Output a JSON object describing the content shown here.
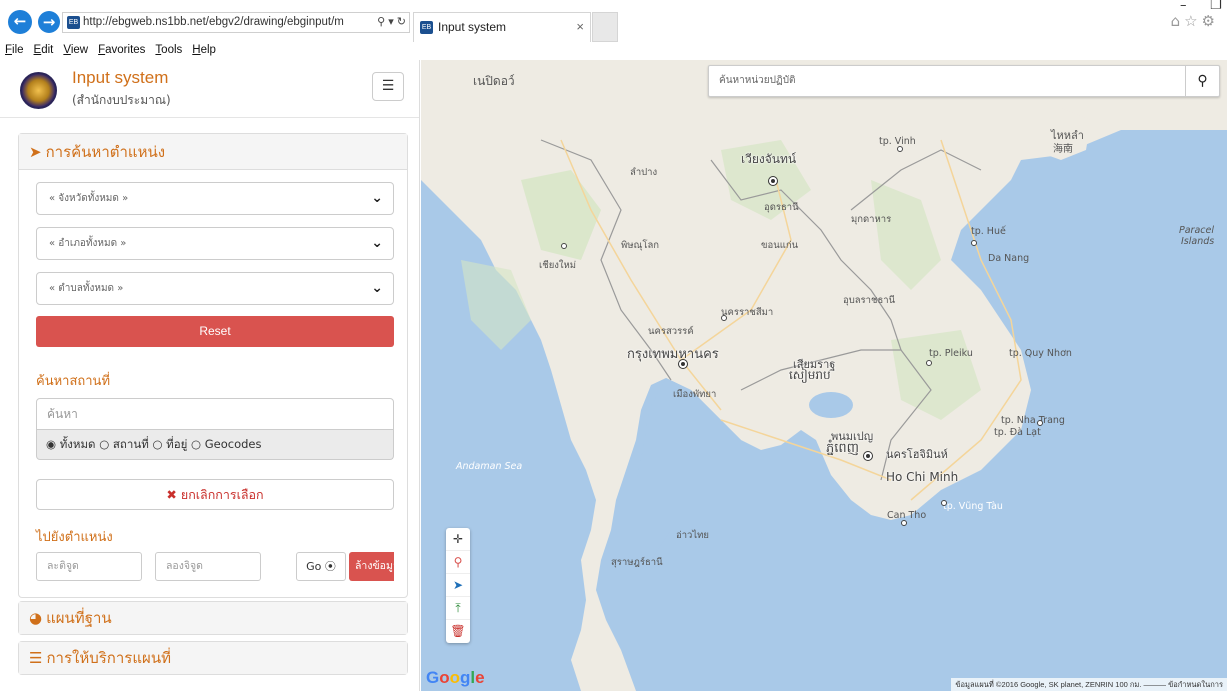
{
  "browser": {
    "url": "http://ebgweb.ns1bb.net/ebgv2/drawing/ebginput/m",
    "addr_tools": "⚲ ▾ ↻",
    "tab_title": "Input system",
    "tab_close": "×",
    "favicon_text": "EB",
    "menu": [
      "File",
      "Edit",
      "View",
      "Favorites",
      "Tools",
      "Help"
    ]
  },
  "sidebar": {
    "title": "Input system",
    "subtitle": "(สำนักงบประมาณ)",
    "location_panel": {
      "title": "การค้นหาตำแหน่ง",
      "province": "« จังหวัดทั้งหมด »",
      "district": "« อำเภอทั้งหมด »",
      "subdistrict": "« ตำบลทั้งหมด »",
      "reset": "Reset",
      "place_label": "ค้นหาสถานที่",
      "search_placeholder": "ค้นหา",
      "radio_all": "ทั้งหมด",
      "radio_place": "สถานที่",
      "radio_address": "ที่อยู่",
      "radio_geocodes": "Geocodes",
      "cancel": "ยกเลิกการเลือก",
      "goto_label": "ไปยังตำแหน่ง",
      "lat_placeholder": "ละติจูด",
      "lng_placeholder": "ลองจิจูด",
      "go": "Go",
      "clear": "ล้างข้อมูล"
    },
    "basemap_panel": {
      "title": "แผนที่ฐาน"
    },
    "service_panel": {
      "title": "การให้บริการแผนที่"
    }
  },
  "map": {
    "search_placeholder": "ค้นหาหน่วยปฏิบัติ",
    "google": "Google",
    "attribution": "ข้อมูลแผนที่ ©2016 Google, SK planet, ZENRIN   100 กม.  ———   ข้อกำหนดในการ",
    "labels": {
      "bangkok": "กรุงเทพมหานคร",
      "vientiane": "เวียงจันทน์",
      "phnom_penh": "พนมเปญ",
      "phnom_penh_km": "ភ្នំពេញ",
      "ho_chi_minh": "Ho Chi Minh",
      "hcm_thai": "นครโฮจิมินห์",
      "siem_reap": "เสียมราฐ",
      "siem_reap_km": "សៀមរាប",
      "andaman": "Andaman Sea",
      "gulf": "อ่าวไทย",
      "paracel": "Paracel",
      "paracel2": "Islands",
      "danang": "Da Nang",
      "nha_trang": "tp. Nha Trang",
      "can_tho": "Can Tho",
      "vung_tau": "tp. Vũng Tàu",
      "pleiku": "tp. Pleiku",
      "quy_nhon": "tp. Quy Nhơn",
      "vinh": "tp. Vinh",
      "hue": "tp. Huế",
      "da_lat": "tp. Đà Lạt",
      "udon": "อุดรธานี",
      "khon_kaen": "ขอนแก่น",
      "korat": "นครราชสีมา",
      "ubon": "อุบลราชธานี",
      "chiang_mai": "เชียงใหม่",
      "lampang": "ลำปาง",
      "phitsanulok": "พิษณุโลก",
      "nakhon_sawan": "นครสวรรค์",
      "pattaya": "เมืองพัทยา",
      "surat": "สุราษฎร์ธานี",
      "hanoi_side": "มุกดาหาร",
      "yangon": "เนปิดอว์",
      "hainan": "ไหหลำ",
      "hainan_zh": "海南"
    }
  },
  "colors": {
    "accent": "#d0701a",
    "danger": "#d9534f",
    "water": "#a9c9e8",
    "land": "#eeebe3"
  }
}
